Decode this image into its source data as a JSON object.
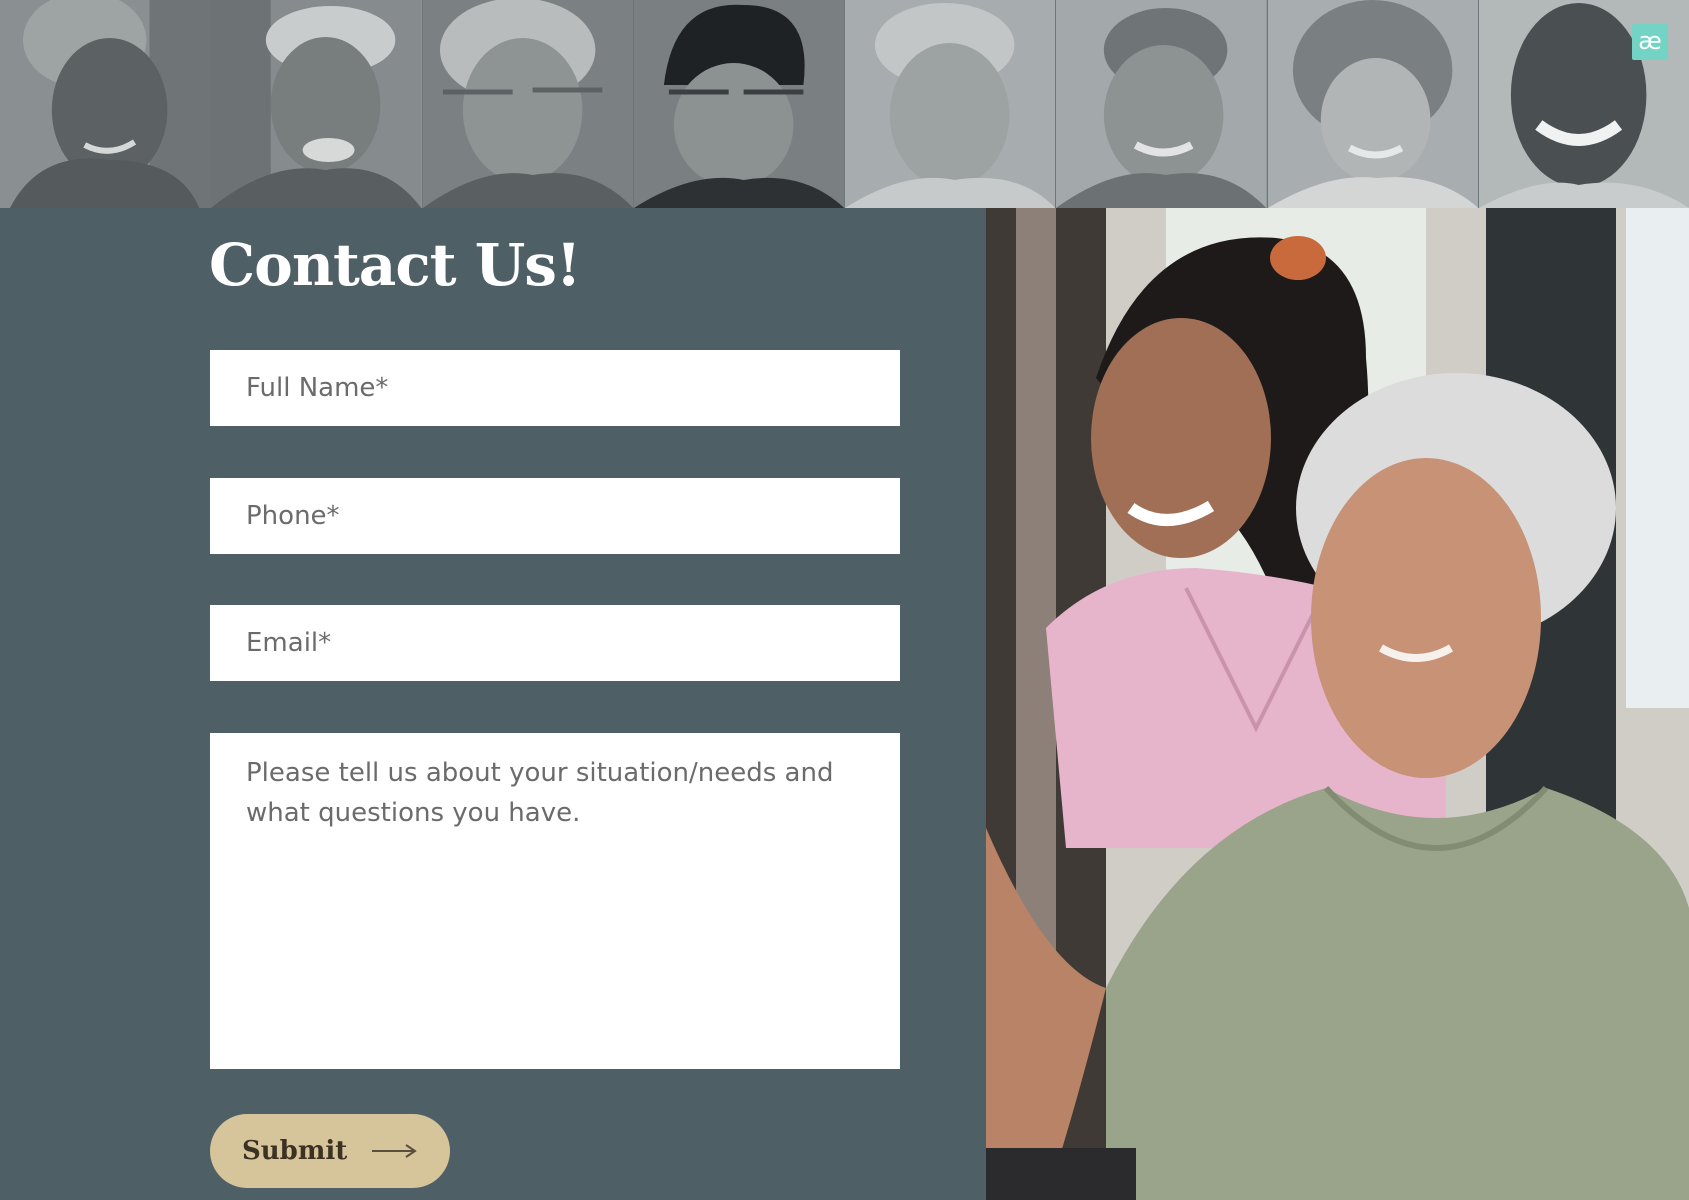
{
  "brand": {
    "badge_glyph": "æ",
    "badge_color": "#73d3c4"
  },
  "portraits": [
    {
      "name": "portrait-1",
      "tone": "#7d8385"
    },
    {
      "name": "portrait-2",
      "tone": "#868c8d"
    },
    {
      "name": "portrait-3",
      "tone": "#8b9192"
    },
    {
      "name": "portrait-4",
      "tone": "#7a8082"
    },
    {
      "name": "portrait-5",
      "tone": "#a4aaab"
    },
    {
      "name": "portrait-6",
      "tone": "#9aa0a1"
    },
    {
      "name": "portrait-7",
      "tone": "#a3a9aa"
    },
    {
      "name": "portrait-8",
      "tone": "#9ea4a5"
    }
  ],
  "contact": {
    "title": "Contact Us!",
    "fields": {
      "full_name_placeholder": "Full Name*",
      "phone_placeholder": "Phone*",
      "email_placeholder": "Email*",
      "message_placeholder": "Please tell us about your situation/needs and what questions you have."
    },
    "submit_label": "Submit"
  },
  "colors": {
    "panel_bg": "#4f5f66",
    "button_bg": "#d6c49a",
    "field_bg": "#ffffff"
  },
  "icons": {
    "submit_arrow": "arrow-right-icon"
  }
}
